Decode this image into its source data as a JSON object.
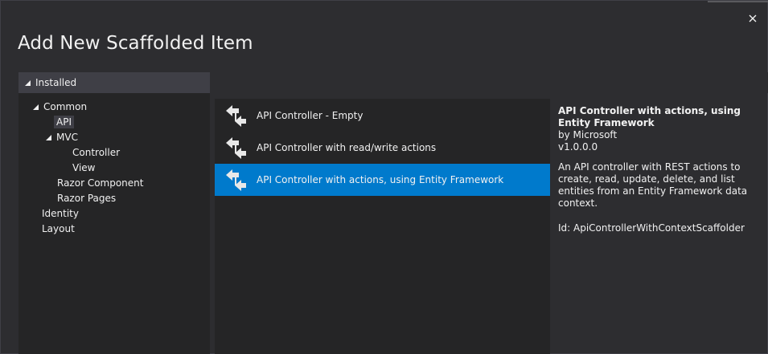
{
  "dialog": {
    "title": "Add New Scaffolded Item",
    "close_icon": "close-icon"
  },
  "installed": {
    "label": "Installed"
  },
  "tree": {
    "common": "Common",
    "api": "API",
    "mvc": "MVC",
    "controller": "Controller",
    "view": "View",
    "razor_component": "Razor Component",
    "razor_pages": "Razor Pages",
    "identity": "Identity",
    "layout": "Layout"
  },
  "templates": [
    {
      "label": "API Controller - Empty",
      "icon": "api-controller-icon"
    },
    {
      "label": "API Controller with read/write actions",
      "icon": "api-controller-icon"
    },
    {
      "label": "API Controller with actions, using Entity Framework",
      "icon": "api-controller-icon"
    }
  ],
  "details": {
    "name": "API Controller with actions, using Entity Framework",
    "author": "by Microsoft",
    "version": "v1.0.0.0",
    "description": "An API controller with REST actions to create, read, update, delete, and list entities from an Entity Framework data context.",
    "id": "Id: ApiControllerWithContextScaffolder"
  },
  "colors": {
    "background": "#2d2d30",
    "panel": "#252526",
    "selection": "#007acc",
    "header_bar": "#3f3f46"
  }
}
